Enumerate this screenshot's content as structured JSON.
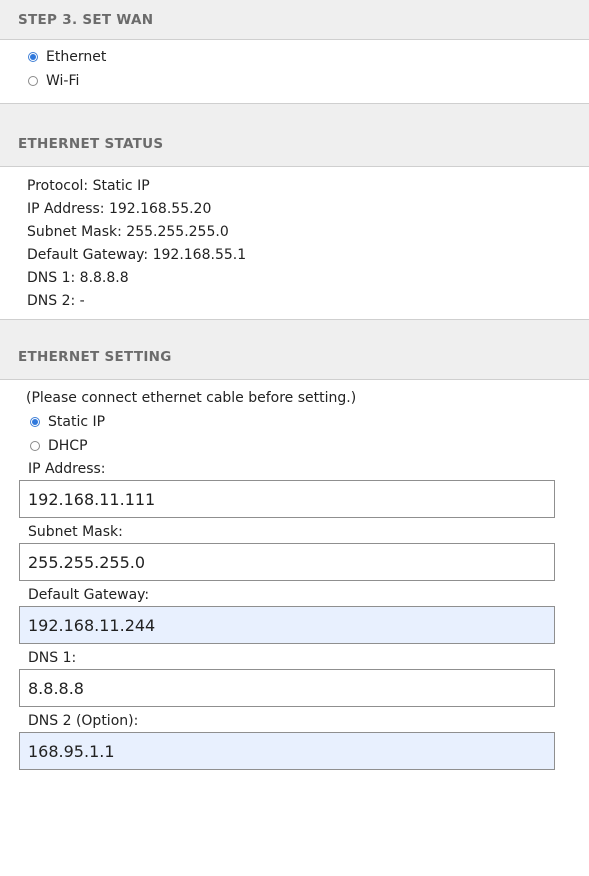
{
  "step_header": "STEP 3. SET WAN",
  "wan_options": [
    {
      "label": "Ethernet",
      "checked": true
    },
    {
      "label": "Wi-Fi",
      "checked": false
    }
  ],
  "status": {
    "header": "ETHERNET STATUS",
    "protocol": "Protocol: Static IP",
    "ip_address": "IP Address: 192.168.55.20",
    "subnet_mask": "Subnet Mask: 255.255.255.0",
    "default_gateway": "Default Gateway: 192.168.55.1",
    "dns1": "DNS 1: 8.8.8.8",
    "dns2": "DNS 2: -"
  },
  "setting": {
    "header": "ETHERNET SETTING",
    "note": "(Please connect ethernet cable before setting.)",
    "mode_options": [
      {
        "label": "Static IP",
        "checked": true
      },
      {
        "label": "DHCP",
        "checked": false
      }
    ],
    "fields": {
      "ip_address": {
        "label": "IP Address:",
        "value": "192.168.11.111"
      },
      "subnet_mask": {
        "label": "Subnet Mask:",
        "value": "255.255.255.0"
      },
      "default_gateway": {
        "label": "Default Gateway:",
        "value": "192.168.11.244"
      },
      "dns1": {
        "label": "DNS 1:",
        "value": "8.8.8.8"
      },
      "dns2": {
        "label": "DNS 2 (Option):",
        "value": "168.95.1.1"
      }
    }
  },
  "colors": {
    "header_bg": "#efefef",
    "header_text": "#6b6b6b",
    "radio_accent": "#2f78dc",
    "autofill_bg": "#e8f0fe"
  }
}
